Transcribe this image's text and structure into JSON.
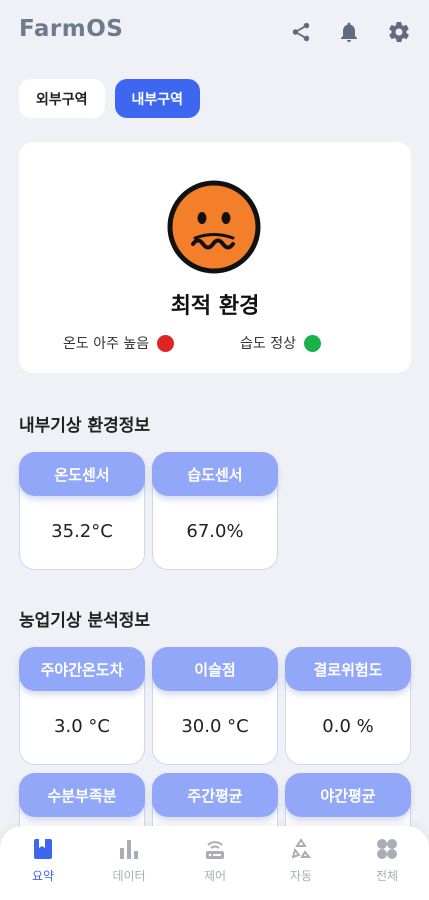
{
  "header": {
    "title": "FarmOS",
    "icons": [
      "share-icon",
      "bell-icon",
      "gear-icon"
    ]
  },
  "tabs": [
    {
      "label": "외부구역",
      "active": false
    },
    {
      "label": "내부구역",
      "active": true
    }
  ],
  "status": {
    "title": "최적 환경",
    "face": "worried-face-icon",
    "items": [
      {
        "label": "온도 아주 높음",
        "color": "#e02424"
      },
      {
        "label": "습도 정상",
        "color": "#17b34a"
      }
    ]
  },
  "sections": {
    "inner_env": {
      "title": "내부기상 환경정보",
      "cards": [
        {
          "label": "온도센서",
          "value": "35.2°C"
        },
        {
          "label": "습도센서",
          "value": "67.0%"
        }
      ]
    },
    "analysis": {
      "title": "농업기상 분석정보",
      "cards": [
        {
          "label": "주야간온도차",
          "value": "3.0 °C"
        },
        {
          "label": "이슬점",
          "value": "30.0 °C"
        },
        {
          "label": "결로위험도",
          "value": "0.0 %"
        },
        {
          "label": "수분부족분",
          "value": ""
        },
        {
          "label": "주간평균",
          "value": ""
        },
        {
          "label": "야간평균",
          "value": ""
        }
      ]
    }
  },
  "nav": [
    {
      "label": "요약",
      "icon": "bookmark-icon",
      "active": true
    },
    {
      "label": "데이터",
      "icon": "bar-chart-icon",
      "active": false
    },
    {
      "label": "제어",
      "icon": "router-icon",
      "active": false
    },
    {
      "label": "자동",
      "icon": "recycle-icon",
      "active": false
    },
    {
      "label": "전체",
      "icon": "grid-icon",
      "active": false
    }
  ],
  "colors": {
    "accent": "#3d67f0",
    "card_header": "#93a7f8",
    "face": "#f37f2a"
  }
}
